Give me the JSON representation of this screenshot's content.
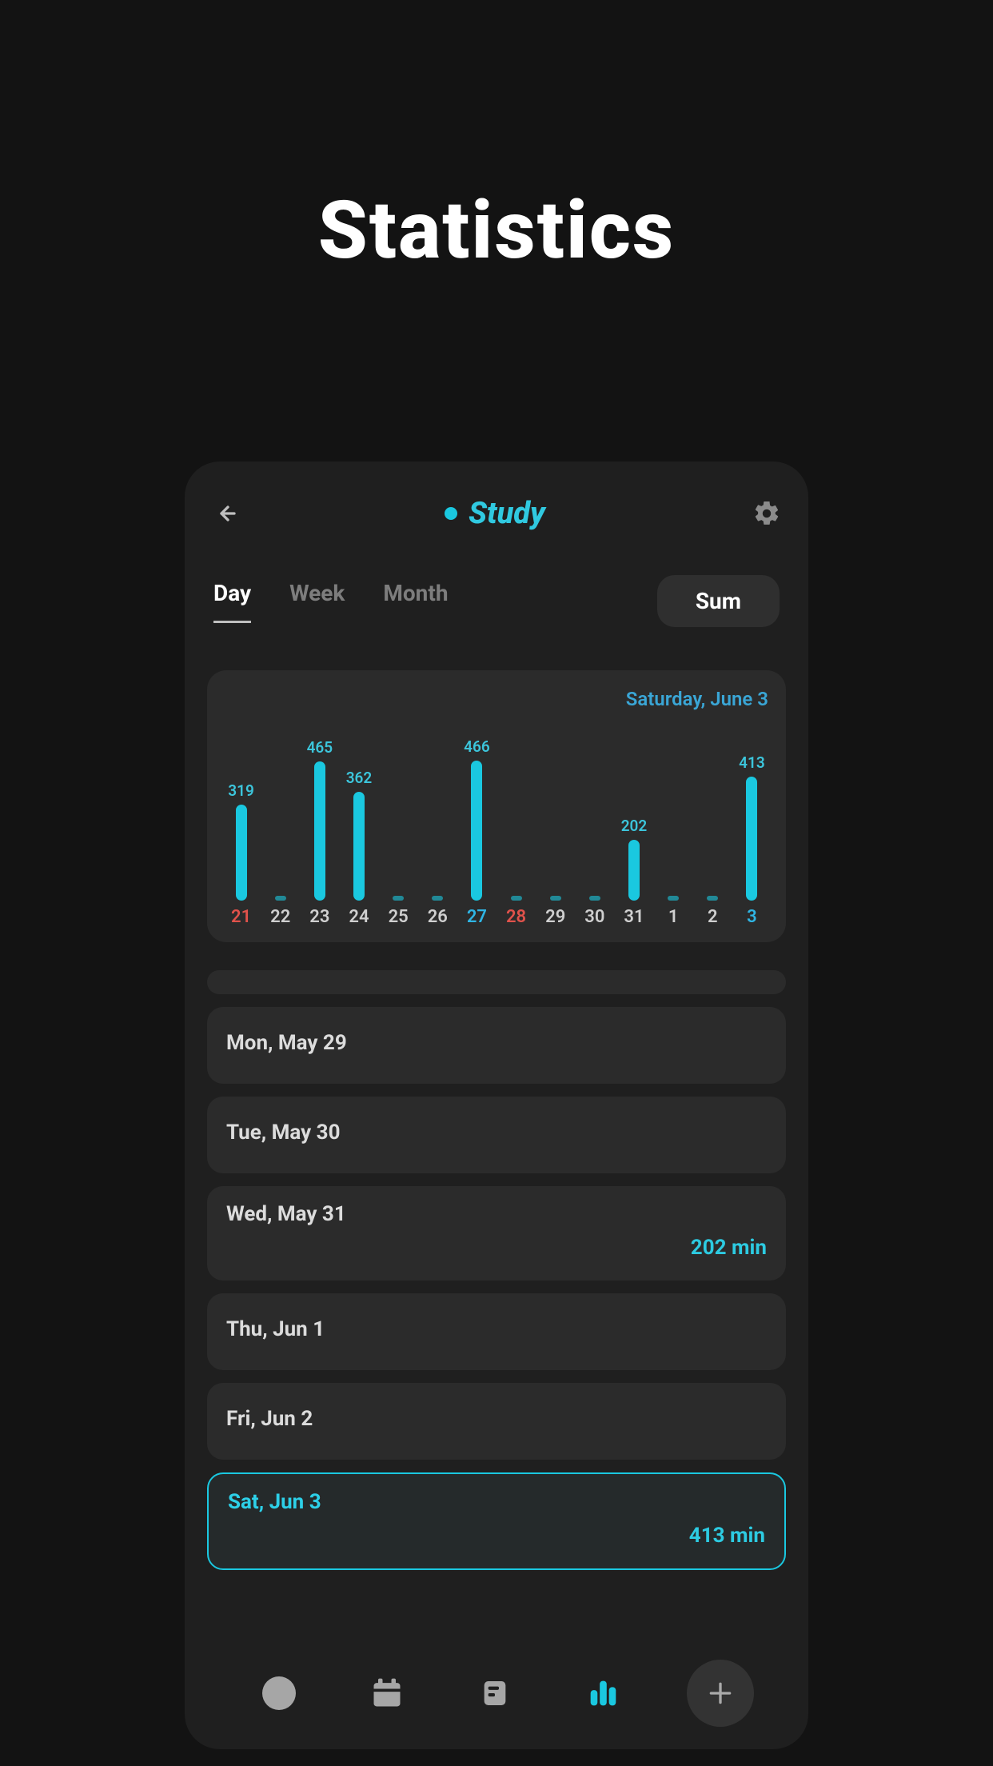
{
  "page_title": "Statistics",
  "topbar": {
    "title": "Study"
  },
  "tabs": {
    "periods": [
      "Day",
      "Week",
      "Month"
    ],
    "active_index": 0,
    "sum_label": "Sum"
  },
  "chart_data": {
    "type": "bar",
    "title_date": "Saturday, June 3",
    "categories": [
      "21",
      "22",
      "23",
      "24",
      "25",
      "26",
      "27",
      "28",
      "29",
      "30",
      "31",
      "1",
      "2",
      "3"
    ],
    "values": [
      319,
      0,
      465,
      362,
      0,
      0,
      466,
      0,
      0,
      0,
      202,
      0,
      0,
      413
    ],
    "show_value": [
      true,
      false,
      true,
      true,
      false,
      false,
      true,
      false,
      false,
      false,
      true,
      false,
      false,
      true
    ],
    "label_color": [
      "red",
      "",
      "",
      "",
      "",
      "",
      "blue",
      "red",
      "",
      "",
      "",
      "",
      "",
      "blue"
    ],
    "ymax": 480
  },
  "list": [
    {
      "date": "Mon, May 29",
      "value": "",
      "selected": false
    },
    {
      "date": "Tue, May 30",
      "value": "",
      "selected": false
    },
    {
      "date": "Wed, May 31",
      "value": "202 min",
      "selected": false
    },
    {
      "date": "Thu, Jun 1",
      "value": "",
      "selected": false
    },
    {
      "date": "Fri, Jun 2",
      "value": "",
      "selected": false
    },
    {
      "date": "Sat, Jun 3",
      "value": "413 min",
      "selected": true
    }
  ],
  "colors": {
    "accent": "#1ac8e0",
    "red": "#e0524b",
    "blue": "#2fb5e4"
  }
}
